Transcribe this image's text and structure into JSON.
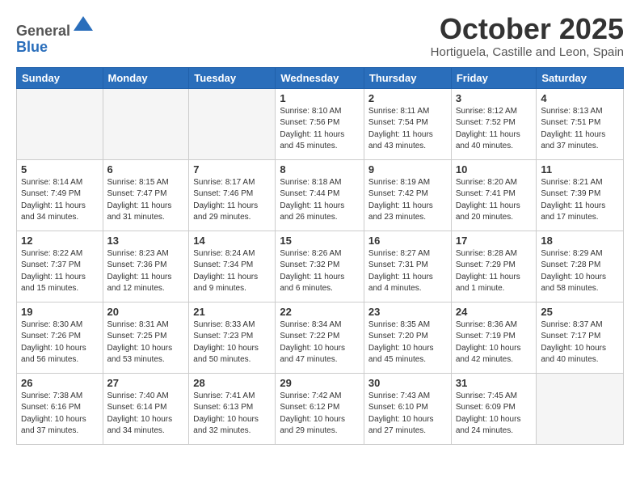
{
  "header": {
    "logo_general": "General",
    "logo_blue": "Blue",
    "month_title": "October 2025",
    "location": "Hortiguela, Castille and Leon, Spain"
  },
  "weekdays": [
    "Sunday",
    "Monday",
    "Tuesday",
    "Wednesday",
    "Thursday",
    "Friday",
    "Saturday"
  ],
  "weeks": [
    [
      {
        "day": "",
        "info": ""
      },
      {
        "day": "",
        "info": ""
      },
      {
        "day": "",
        "info": ""
      },
      {
        "day": "1",
        "info": "Sunrise: 8:10 AM\nSunset: 7:56 PM\nDaylight: 11 hours and 45 minutes."
      },
      {
        "day": "2",
        "info": "Sunrise: 8:11 AM\nSunset: 7:54 PM\nDaylight: 11 hours and 43 minutes."
      },
      {
        "day": "3",
        "info": "Sunrise: 8:12 AM\nSunset: 7:52 PM\nDaylight: 11 hours and 40 minutes."
      },
      {
        "day": "4",
        "info": "Sunrise: 8:13 AM\nSunset: 7:51 PM\nDaylight: 11 hours and 37 minutes."
      }
    ],
    [
      {
        "day": "5",
        "info": "Sunrise: 8:14 AM\nSunset: 7:49 PM\nDaylight: 11 hours and 34 minutes."
      },
      {
        "day": "6",
        "info": "Sunrise: 8:15 AM\nSunset: 7:47 PM\nDaylight: 11 hours and 31 minutes."
      },
      {
        "day": "7",
        "info": "Sunrise: 8:17 AM\nSunset: 7:46 PM\nDaylight: 11 hours and 29 minutes."
      },
      {
        "day": "8",
        "info": "Sunrise: 8:18 AM\nSunset: 7:44 PM\nDaylight: 11 hours and 26 minutes."
      },
      {
        "day": "9",
        "info": "Sunrise: 8:19 AM\nSunset: 7:42 PM\nDaylight: 11 hours and 23 minutes."
      },
      {
        "day": "10",
        "info": "Sunrise: 8:20 AM\nSunset: 7:41 PM\nDaylight: 11 hours and 20 minutes."
      },
      {
        "day": "11",
        "info": "Sunrise: 8:21 AM\nSunset: 7:39 PM\nDaylight: 11 hours and 17 minutes."
      }
    ],
    [
      {
        "day": "12",
        "info": "Sunrise: 8:22 AM\nSunset: 7:37 PM\nDaylight: 11 hours and 15 minutes."
      },
      {
        "day": "13",
        "info": "Sunrise: 8:23 AM\nSunset: 7:36 PM\nDaylight: 11 hours and 12 minutes."
      },
      {
        "day": "14",
        "info": "Sunrise: 8:24 AM\nSunset: 7:34 PM\nDaylight: 11 hours and 9 minutes."
      },
      {
        "day": "15",
        "info": "Sunrise: 8:26 AM\nSunset: 7:32 PM\nDaylight: 11 hours and 6 minutes."
      },
      {
        "day": "16",
        "info": "Sunrise: 8:27 AM\nSunset: 7:31 PM\nDaylight: 11 hours and 4 minutes."
      },
      {
        "day": "17",
        "info": "Sunrise: 8:28 AM\nSunset: 7:29 PM\nDaylight: 11 hours and 1 minute."
      },
      {
        "day": "18",
        "info": "Sunrise: 8:29 AM\nSunset: 7:28 PM\nDaylight: 10 hours and 58 minutes."
      }
    ],
    [
      {
        "day": "19",
        "info": "Sunrise: 8:30 AM\nSunset: 7:26 PM\nDaylight: 10 hours and 56 minutes."
      },
      {
        "day": "20",
        "info": "Sunrise: 8:31 AM\nSunset: 7:25 PM\nDaylight: 10 hours and 53 minutes."
      },
      {
        "day": "21",
        "info": "Sunrise: 8:33 AM\nSunset: 7:23 PM\nDaylight: 10 hours and 50 minutes."
      },
      {
        "day": "22",
        "info": "Sunrise: 8:34 AM\nSunset: 7:22 PM\nDaylight: 10 hours and 47 minutes."
      },
      {
        "day": "23",
        "info": "Sunrise: 8:35 AM\nSunset: 7:20 PM\nDaylight: 10 hours and 45 minutes."
      },
      {
        "day": "24",
        "info": "Sunrise: 8:36 AM\nSunset: 7:19 PM\nDaylight: 10 hours and 42 minutes."
      },
      {
        "day": "25",
        "info": "Sunrise: 8:37 AM\nSunset: 7:17 PM\nDaylight: 10 hours and 40 minutes."
      }
    ],
    [
      {
        "day": "26",
        "info": "Sunrise: 7:38 AM\nSunset: 6:16 PM\nDaylight: 10 hours and 37 minutes."
      },
      {
        "day": "27",
        "info": "Sunrise: 7:40 AM\nSunset: 6:14 PM\nDaylight: 10 hours and 34 minutes."
      },
      {
        "day": "28",
        "info": "Sunrise: 7:41 AM\nSunset: 6:13 PM\nDaylight: 10 hours and 32 minutes."
      },
      {
        "day": "29",
        "info": "Sunrise: 7:42 AM\nSunset: 6:12 PM\nDaylight: 10 hours and 29 minutes."
      },
      {
        "day": "30",
        "info": "Sunrise: 7:43 AM\nSunset: 6:10 PM\nDaylight: 10 hours and 27 minutes."
      },
      {
        "day": "31",
        "info": "Sunrise: 7:45 AM\nSunset: 6:09 PM\nDaylight: 10 hours and 24 minutes."
      },
      {
        "day": "",
        "info": ""
      }
    ]
  ]
}
